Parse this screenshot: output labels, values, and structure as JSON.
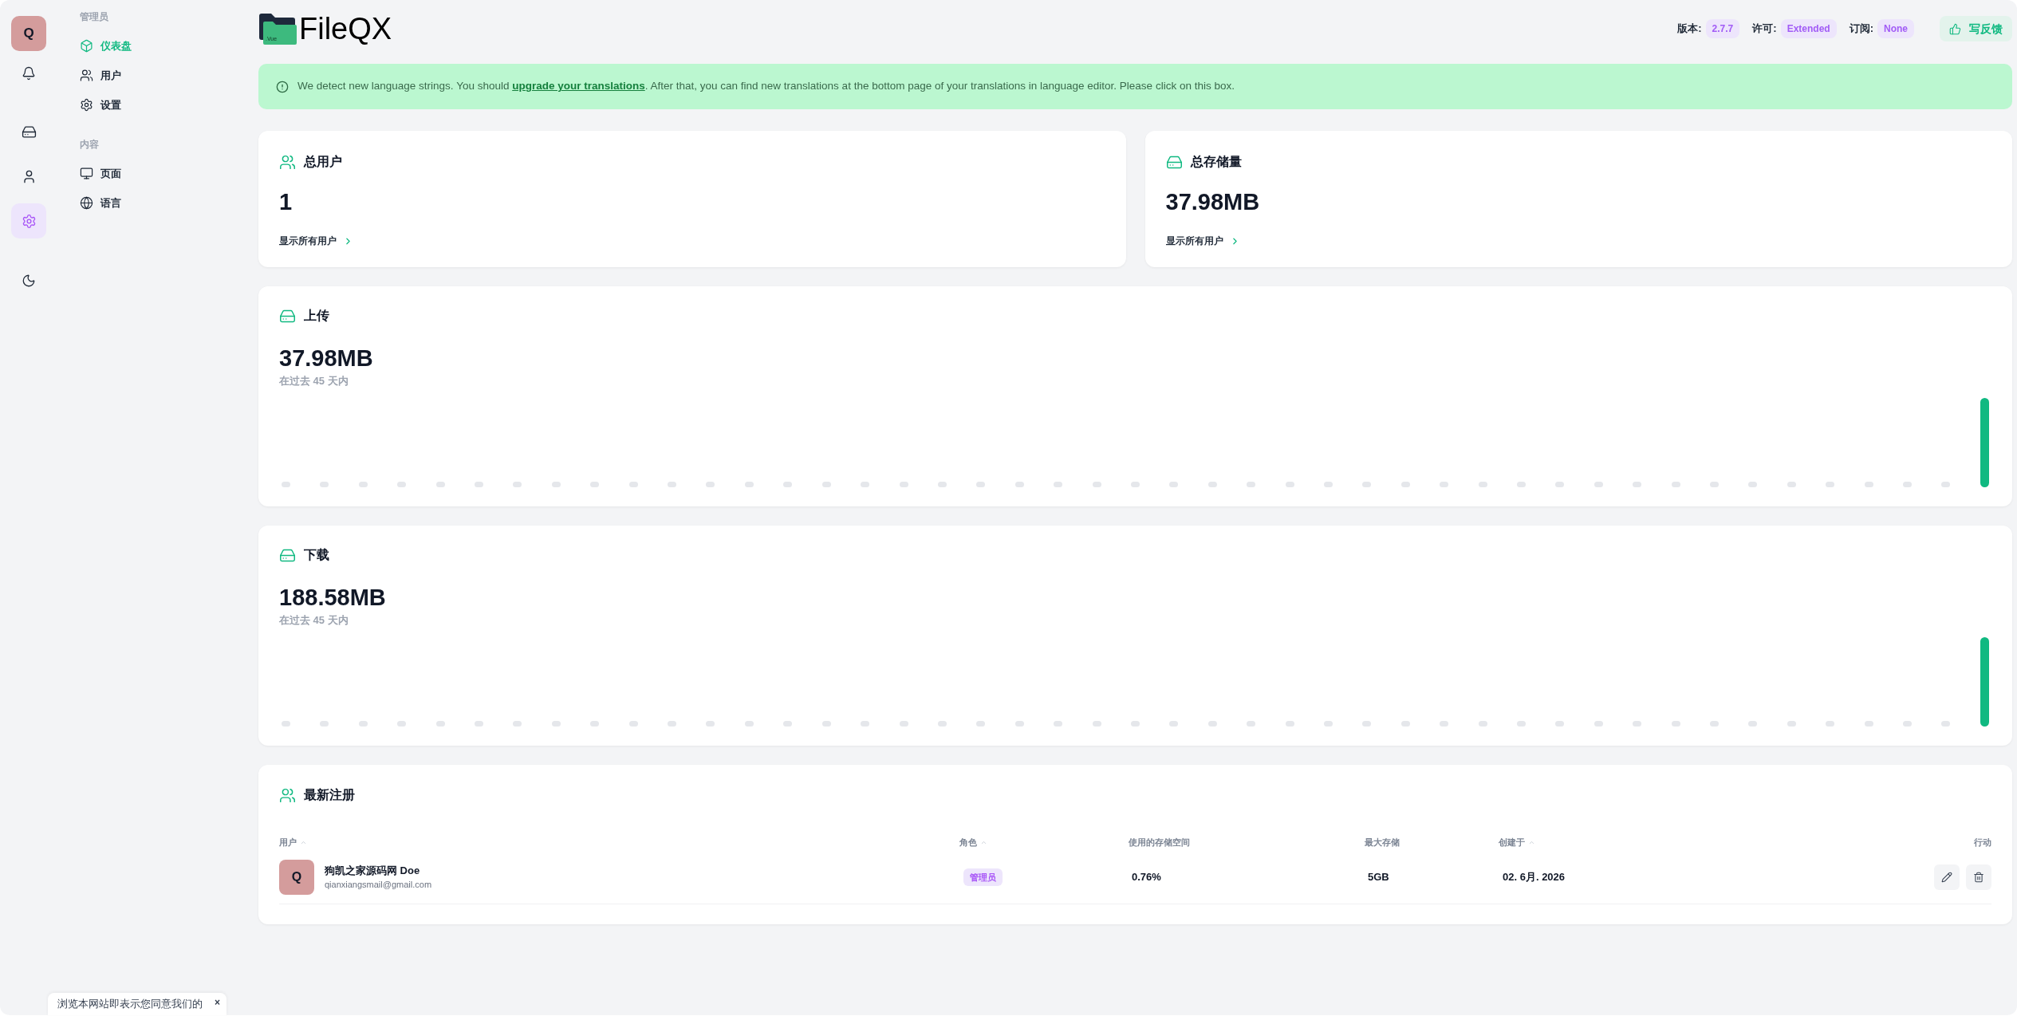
{
  "rail": {
    "avatar": "Q",
    "nav": [
      {
        "selected": false
      },
      {
        "selected": false
      },
      {
        "selected": true
      }
    ]
  },
  "sidebar": {
    "sections": [
      {
        "heading": "管理员",
        "items": [
          {
            "label": "仪表盘",
            "selected": true
          },
          {
            "label": "用户",
            "selected": false
          },
          {
            "label": "设置",
            "selected": false
          }
        ]
      },
      {
        "heading": "内容",
        "items": [
          {
            "label": "页面",
            "selected": false
          },
          {
            "label": "语言",
            "selected": false
          }
        ]
      }
    ]
  },
  "header": {
    "logo": {
      "badge": ".Vue",
      "name": "FileQX"
    },
    "info": [
      {
        "label": "版本:",
        "value": "2.7.7"
      },
      {
        "label": "许可:",
        "value": "Extended"
      },
      {
        "label": "订阅:",
        "value": "None"
      }
    ],
    "feedback_button": "写反馈"
  },
  "alert": {
    "text_before": "We detect new language strings. You should ",
    "link": "upgrade your translations",
    "text_after": ". After that, you can find new translations at the bottom page of your translations in language editor. Please click on this box."
  },
  "stats": [
    {
      "title": "总用户",
      "value": "1",
      "link": "显示所有用户"
    },
    {
      "title": "总存储量",
      "value": "37.98MB",
      "link": "显示所有用户"
    }
  ],
  "transfers": [
    {
      "title": "上传",
      "value": "37.98MB",
      "caption": "在过去 45 天内"
    },
    {
      "title": "下载",
      "value": "188.58MB",
      "caption": "在过去 45 天内"
    }
  ],
  "recent": {
    "title": "最新注册",
    "columns": [
      {
        "label": "用户",
        "sortable": true
      },
      {
        "label": "角色",
        "sortable": true
      },
      {
        "label": "使用的存储空间",
        "sortable": false
      },
      {
        "label": "最大存储",
        "sortable": false
      },
      {
        "label": "创建于",
        "sortable": true
      },
      {
        "label": "行动",
        "sortable": false
      }
    ],
    "rows": [
      {
        "avatar": "Q",
        "name": "狗凯之家源码网 Doe",
        "email": "qianxiangsmail@gmail.com",
        "role": "管理员",
        "used": "0.76%",
        "max": "5GB",
        "created": "02. 6月. 2026"
      }
    ]
  },
  "cookie": {
    "text": "浏览本网站即表示您同意我们的",
    "close": "×"
  }
}
